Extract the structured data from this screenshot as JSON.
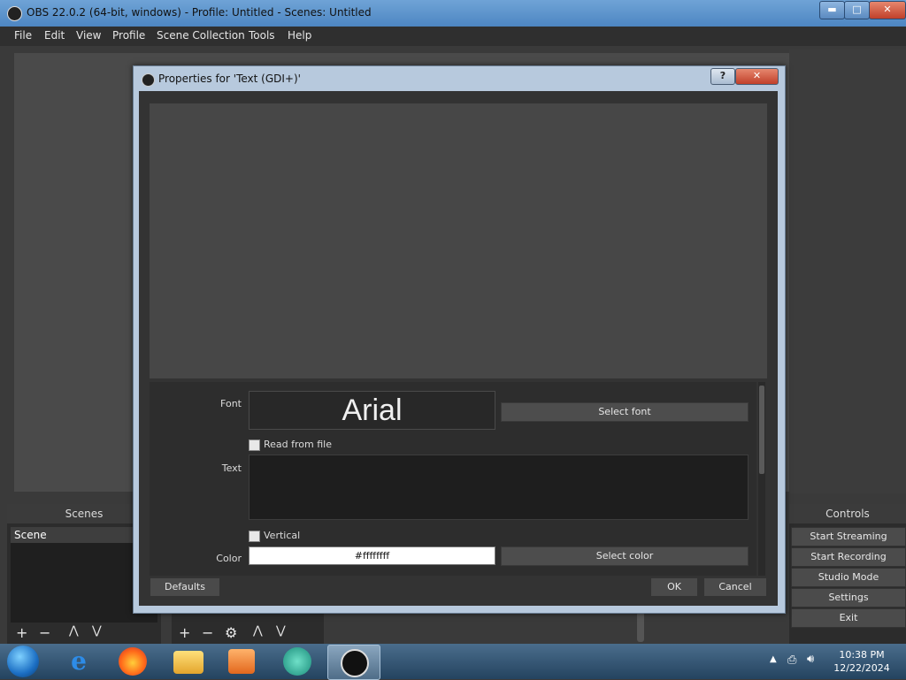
{
  "window": {
    "title": "OBS 22.0.2 (64-bit, windows) - Profile: Untitled - Scenes: Untitled",
    "minimize": "▬",
    "maximize": "□",
    "close": "✕"
  },
  "menu": [
    "File",
    "Edit",
    "View",
    "Profile",
    "Scene Collection",
    "Tools",
    "Help"
  ],
  "scenes": {
    "header": "Scenes",
    "items": [
      "Scene"
    ]
  },
  "controls": {
    "header": "Controls",
    "buttons": [
      "Start Streaming",
      "Start Recording",
      "Studio Mode",
      "Settings",
      "Exit"
    ]
  },
  "dialog": {
    "title": "Properties for 'Text (GDI+)'",
    "help": "?",
    "close": "✕",
    "font_label": "Font",
    "font_value": "Arial",
    "select_font": "Select font",
    "read_from_file": "Read from file",
    "text_label": "Text",
    "text_value": "",
    "vertical": "Vertical",
    "color_label": "Color",
    "color_value": "#ffffffff",
    "select_color": "Select color",
    "defaults": "Defaults",
    "ok": "OK",
    "cancel": "Cancel"
  },
  "taskbar": {
    "time": "10:38 PM",
    "date": "12/22/2024"
  },
  "icons": [
    "start-orb-icon",
    "internet-explorer-icon",
    "firefox-icon",
    "file-explorer-icon",
    "media-player-icon",
    "app-icon",
    "obs-icon",
    "network-icon",
    "volume-icon"
  ]
}
